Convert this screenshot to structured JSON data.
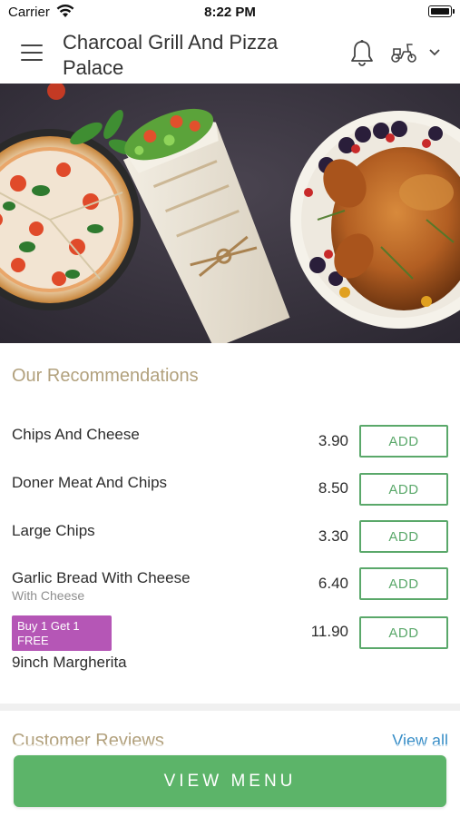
{
  "status_bar": {
    "carrier": "Carrier",
    "time": "8:22 PM"
  },
  "header": {
    "title": "Charcoal Grill And Pizza Palace"
  },
  "icons": [
    "menu-icon",
    "bell-icon",
    "scooter-icon",
    "chevron-down-icon",
    "wifi-icon",
    "battery-icon"
  ],
  "recommendations": {
    "title": "Our Recommendations",
    "add_label": "ADD",
    "items": [
      {
        "name": "Chips And Cheese",
        "subtitle": "",
        "price": "3.90"
      },
      {
        "name": "Doner Meat And Chips",
        "subtitle": "",
        "price": "8.50"
      },
      {
        "name": "Large Chips",
        "subtitle": "",
        "price": "3.30"
      },
      {
        "name": "Garlic Bread With Cheese",
        "subtitle": "With Cheese",
        "price": "6.40"
      },
      {
        "name": "9inch Margherita",
        "subtitle": "",
        "price": "11.90",
        "promo": "Buy 1 Get 1 FREE"
      }
    ]
  },
  "reviews": {
    "title": "Customer Reviews",
    "view_all": "View all"
  },
  "footer": {
    "view_menu": "VIEW MENU"
  },
  "colors": {
    "accent_green": "#5cb469",
    "section_title": "#b2a17d",
    "promo": "#b556b6",
    "link": "#3a8fc8"
  }
}
